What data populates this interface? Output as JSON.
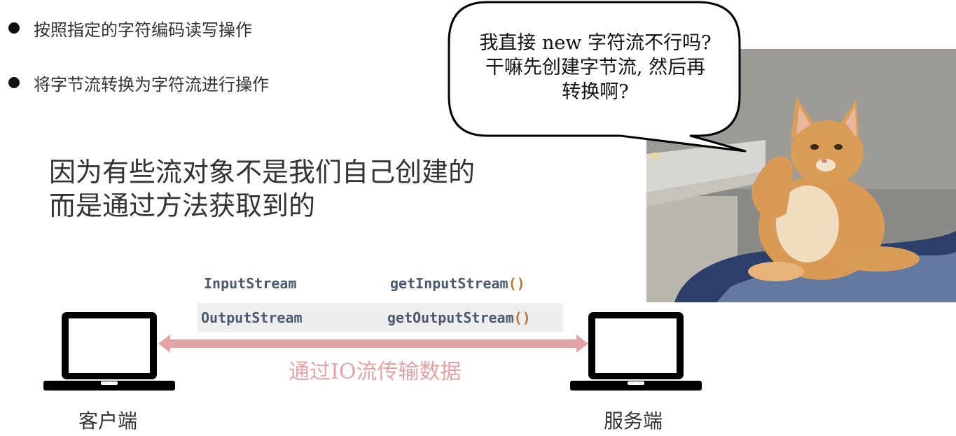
{
  "bullets": [
    "按照指定的字符编码读写操作",
    "将字节流转换为字符流进行操作"
  ],
  "headline": {
    "line1": "因为有些流对象不是我们自己创建的",
    "line2": "而是通过方法获取到的"
  },
  "api_table": [
    {
      "stream_class": "InputStream",
      "method_name": "getInputStream",
      "parens": "()"
    },
    {
      "stream_class": "OutputStream",
      "method_name": "getOutputStream",
      "parens": "()"
    }
  ],
  "transfer": {
    "label": "通过IO流传输数据"
  },
  "client": {
    "label": "客户端"
  },
  "server": {
    "label": "服务端"
  },
  "speech_bubble": {
    "line1": "我直接 new 字符流不行吗?",
    "line2": "干嘛先创建字节流, 然后再",
    "line3": "转换啊?"
  },
  "colors": {
    "arrow": "#e4a3a6",
    "code_text": "#4a5a72",
    "paren": "#b57a2a",
    "row_highlight": "#efefef"
  },
  "icons": [
    "bullet-dot",
    "laptop-icon",
    "double-arrow",
    "cat-photo",
    "speech-bubble"
  ]
}
